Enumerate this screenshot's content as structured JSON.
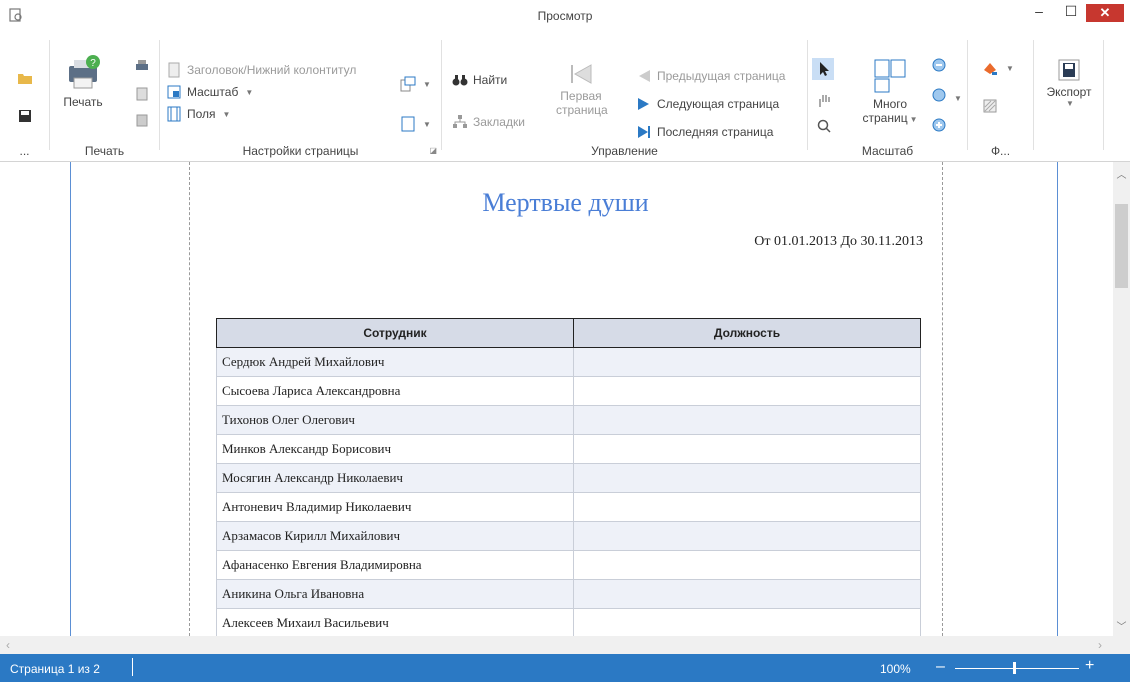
{
  "window": {
    "title": "Просмотр",
    "minimize": "–",
    "maximize": "☐",
    "close": "✕"
  },
  "ribbon": {
    "more": "...",
    "print_group": {
      "label": "Печать",
      "print_button": "Печать"
    },
    "page_setup_group": {
      "label": "Настройки страницы",
      "header_footer": "Заголовок/Нижний колонтитул",
      "scale": "Масштаб",
      "margins": "Поля"
    },
    "navigation_group": {
      "label": "Управление",
      "find": "Найти",
      "bookmarks": "Закладки",
      "first_page_line1": "Первая",
      "first_page_line2": "страница",
      "prev_page": "Предыдущая страница",
      "next_page": "Следующая страница",
      "last_page": "Последняя страница"
    },
    "zoom_group": {
      "label": "Масштаб",
      "many_pages_line1": "Много",
      "many_pages_line2": "страниц"
    },
    "format_group": {
      "label": "Ф..."
    },
    "export_group": {
      "export": "Экспорт"
    }
  },
  "report": {
    "title": "Мертвые души",
    "period": "От 01.01.2013 До 30.11.2013",
    "columns": [
      "Сотрудник",
      "Должность"
    ],
    "rows": [
      [
        "Сердюк Андрей Михайлович",
        ""
      ],
      [
        "Сысоева Лариса Александровна",
        ""
      ],
      [
        "Тихонов Олег Олегович",
        ""
      ],
      [
        "Минков Александр Борисович",
        ""
      ],
      [
        "Мосягин Александр Николаевич",
        ""
      ],
      [
        "Антоневич Владимир Николаевич",
        ""
      ],
      [
        "Арзамасов Кирилл Михайлович",
        ""
      ],
      [
        "Афанасенко Евгения Владимировна",
        ""
      ],
      [
        "Аникина Ольга Ивановна",
        ""
      ],
      [
        "Алексеев Михаил Васильевич",
        ""
      ]
    ]
  },
  "status": {
    "page": "Страница 1 из 2",
    "zoom": "100%",
    "zoom_minus": "–",
    "zoom_plus": "+"
  },
  "colors": {
    "accent": "#2b79c4",
    "title": "#4a7ed6",
    "header_bg": "#d6dbe7"
  }
}
